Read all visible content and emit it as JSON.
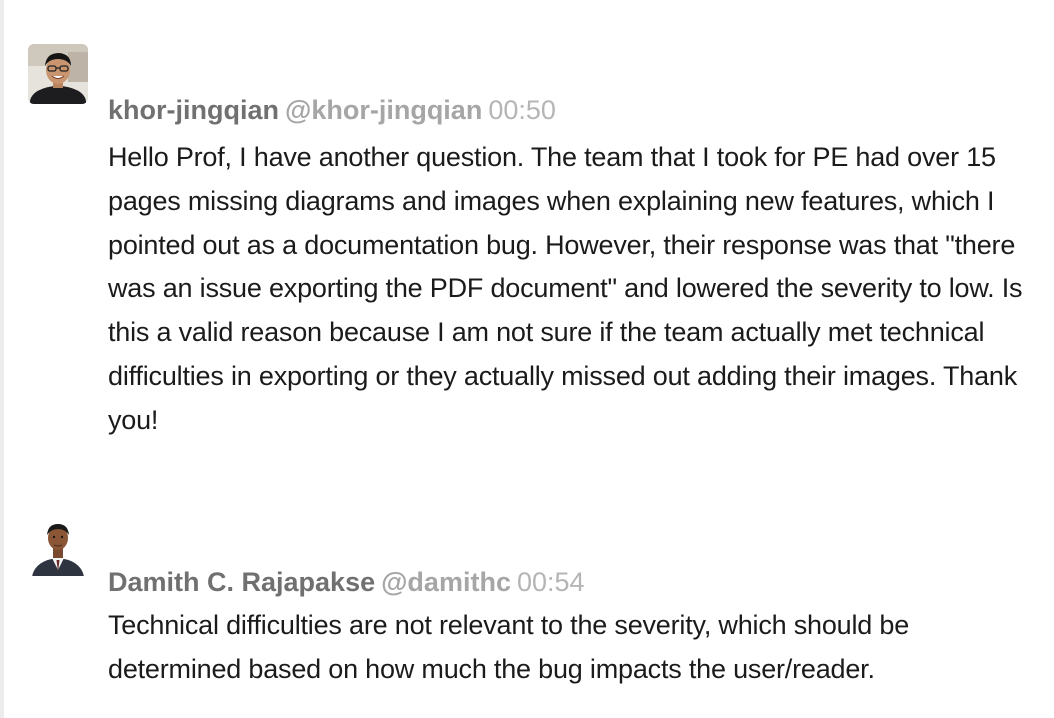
{
  "messages": [
    {
      "author_name": "khor-jingqian",
      "author_handle": "@khor-jingqian",
      "time": "00:50",
      "avatar_icon": "user-photo-icon",
      "text": "Hello Prof, I have another question. The team that I took for PE had over 15 pages missing diagrams and images when explaining new features, which I pointed out as a documentation bug. However, their response was that \"there was an issue exporting the PDF document\" and lowered the severity to low. Is this a valid reason because I am not sure if the team actually met technical difficulties in exporting or they actually missed out adding their images. Thank you!"
    },
    {
      "author_name": "Damith C. Rajapakse",
      "author_handle": "@damithc",
      "time": "00:54",
      "avatar_icon": "user-photo-icon",
      "text": "Technical difficulties are not relevant to the severity, which should be determined based on how much the bug impacts the user/reader."
    }
  ],
  "colors": {
    "name": "#707070",
    "handle": "#a6a6a6",
    "time": "#b5b5b5",
    "text": "#1b1b1b"
  }
}
